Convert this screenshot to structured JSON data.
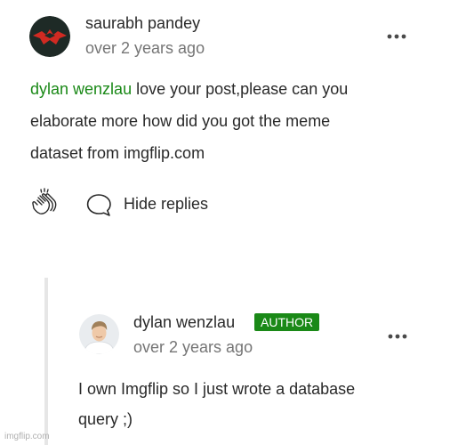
{
  "comment": {
    "author": "saurabh pandey",
    "time": "over 2 years ago",
    "mention": "dylan wenzlau",
    "body_lines": [
      " love your post,please can you",
      "elaborate more how did you got the meme",
      "dataset from imgflip.com"
    ],
    "actions": {
      "clap_icon": "clap-icon",
      "reply_icon": "speech-bubble-icon",
      "hide_replies": "Hide replies"
    },
    "more_icon": "more-horizontal-icon"
  },
  "reply": {
    "author": "dylan wenzlau",
    "badge": "AUTHOR",
    "time": "over 2 years ago",
    "body_lines": [
      "I own Imgflip so I just wrote a database",
      "query ;)"
    ],
    "more_icon": "more-horizontal-icon"
  },
  "watermark": "imgflip.com",
  "colors": {
    "mention": "#1a8917",
    "badge_bg": "#1a8917",
    "text": "#292929",
    "muted": "#757575",
    "thread_line": "#e6e6e6"
  }
}
